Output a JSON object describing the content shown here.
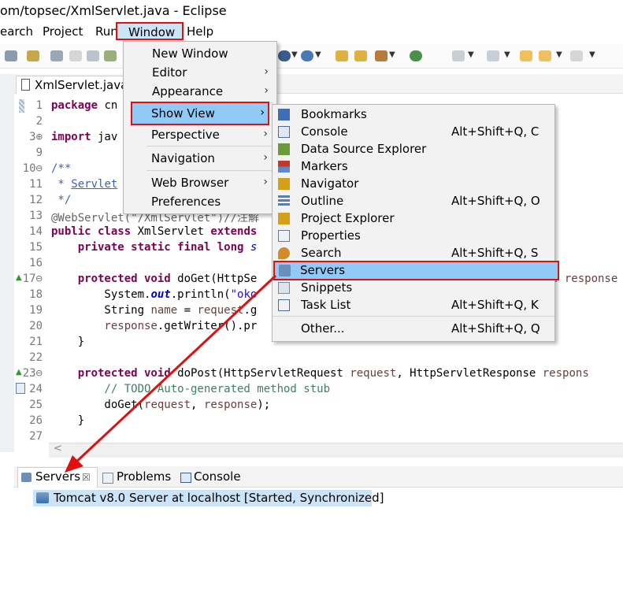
{
  "window": {
    "title": "om/topsec/XmlServlet.java - Eclipse"
  },
  "menubar": {
    "items": [
      "earch",
      "Project",
      "Run",
      "Window",
      "Help"
    ]
  },
  "editor": {
    "tab_label": "XmlServlet.java",
    "lines": [
      {
        "n": "1"
      },
      {
        "n": "2"
      },
      {
        "n": "3⊕"
      },
      {
        "n": "9"
      },
      {
        "n": "10⊖"
      },
      {
        "n": "11"
      },
      {
        "n": "12"
      },
      {
        "n": "13"
      },
      {
        "n": "14"
      },
      {
        "n": "15"
      },
      {
        "n": "16"
      },
      {
        "n": "17⊖"
      },
      {
        "n": "18"
      },
      {
        "n": "19"
      },
      {
        "n": "20"
      },
      {
        "n": "21"
      },
      {
        "n": "22"
      },
      {
        "n": "23⊖"
      },
      {
        "n": "24"
      },
      {
        "n": "25"
      },
      {
        "n": "26"
      },
      {
        "n": "27"
      }
    ],
    "code": {
      "l1_kw": "package",
      "l1_rest": " cn",
      "l3_kw": "import",
      "l3_rest": " jav",
      "l10": "/**",
      "l11_a": " * ",
      "l11_b": "Servlet",
      "l12": " */",
      "l13_ann": "@WebServlet(\"/XmlServlet\")//注解",
      "l14_kw": "public class",
      "l14_rest": " XmlServlet ",
      "l14_kw2": "extends",
      "l15_kw": "    private static final long",
      "l15_rest": " s",
      "l17_kw": "    protected void",
      "l17_rest": " doGet(HttpSe",
      "l17_tail": "e response",
      "l18_a": "        System.",
      "l18_out": "out",
      "l18_b": ".println(",
      "l18_str": "\"oko",
      "l19_a": "        String ",
      "l19_var": "name",
      "l19_b": " = ",
      "l19_var2": "request",
      "l19_c": ".g",
      "l20_var": "        response",
      "l20_b": ".getWriter().pr",
      "l21": "    }",
      "l23_kw": "    protected void",
      "l23_rest": " doPost(HttpServletRequest ",
      "l23_var": "request",
      "l23_mid": ", HttpServletResponse ",
      "l23_var2": "respons",
      "l24_cmt": "        // TODO Auto-generated method stub",
      "l25_a": "        doGet(",
      "l25_var": "request",
      "l25_b": ", ",
      "l25_var2": "response",
      "l25_c": ");",
      "l26": "    }"
    }
  },
  "window_menu": {
    "items": [
      {
        "label": "New Window",
        "submenu": false
      },
      {
        "label": "Editor",
        "submenu": true
      },
      {
        "label": "Appearance",
        "submenu": true
      },
      {
        "label": "Show View",
        "submenu": true
      },
      {
        "label": "Perspective",
        "submenu": true
      },
      {
        "label": "Navigation",
        "submenu": true
      },
      {
        "label": "Web Browser",
        "submenu": true
      },
      {
        "label": "Preferences",
        "submenu": false
      }
    ],
    "chevron": "›"
  },
  "show_view_menu": {
    "items": [
      {
        "label": "Bookmarks",
        "shortcut": "",
        "icon": "bookmarks-icon",
        "color": "#3d6fb6"
      },
      {
        "label": "Console",
        "shortcut": "Alt+Shift+Q, C",
        "icon": "console-icon",
        "color": "#4a6c9b"
      },
      {
        "label": "Data Source Explorer",
        "shortcut": "",
        "icon": "data-source-icon",
        "color": "#6a9a3a"
      },
      {
        "label": "Markers",
        "shortcut": "",
        "icon": "markers-icon",
        "color": "#c0392b"
      },
      {
        "label": "Navigator",
        "shortcut": "",
        "icon": "navigator-icon",
        "color": "#d4a017"
      },
      {
        "label": "Outline",
        "shortcut": "Alt+Shift+Q, O",
        "icon": "outline-icon",
        "color": "#5b7fa8"
      },
      {
        "label": "Project Explorer",
        "shortcut": "",
        "icon": "project-explorer-icon",
        "color": "#d4a017"
      },
      {
        "label": "Properties",
        "shortcut": "",
        "icon": "properties-icon",
        "color": "#6b7b8c"
      },
      {
        "label": "Search",
        "shortcut": "Alt+Shift+Q, S",
        "icon": "search-icon",
        "color": "#d28a2a"
      },
      {
        "label": "Servers",
        "shortcut": "",
        "icon": "servers-icon",
        "color": "#4a6c9b"
      },
      {
        "label": "Snippets",
        "shortcut": "",
        "icon": "snippets-icon",
        "color": "#7a8a9a"
      },
      {
        "label": "Task List",
        "shortcut": "Alt+Shift+Q, K",
        "icon": "task-list-icon",
        "color": "#4a6c9b"
      },
      {
        "label": "Other...",
        "shortcut": "Alt+Shift+Q, Q",
        "icon": "",
        "color": ""
      }
    ]
  },
  "bottom_panel": {
    "tabs": [
      {
        "label": "Servers",
        "close": "☒"
      },
      {
        "label": "Problems"
      },
      {
        "label": "Console"
      }
    ],
    "server_row": "Tomcat v8.0 Server at localhost  [Started, Synchronized]"
  },
  "colors": {
    "highlight_box": "#e01010",
    "selection": "#91c9f7",
    "arrow": "#e01010"
  }
}
